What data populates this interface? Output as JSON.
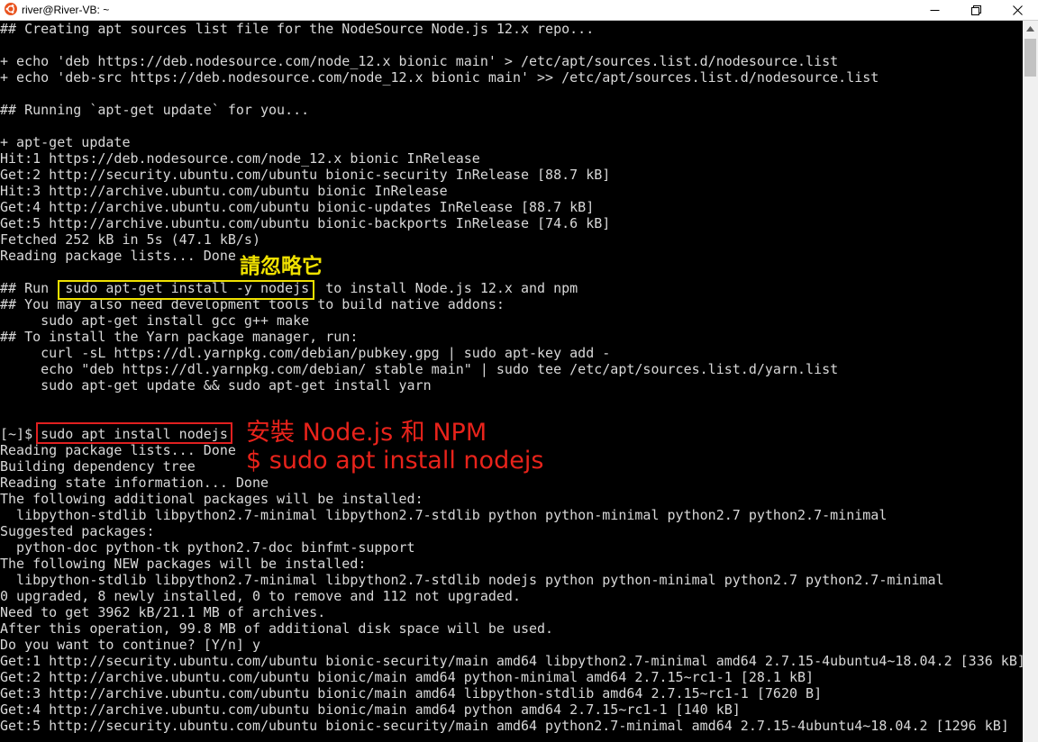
{
  "window": {
    "title": "river@River-VB: ~"
  },
  "icons": {
    "app": "ubuntu-logo-icon",
    "minimize": "minimize-icon",
    "maximize": "maximize-icon",
    "close": "close-icon",
    "scroll_up": "scroll-up-arrow-icon"
  },
  "colors": {
    "background": "#000000",
    "foreground": "#d8d8d8",
    "highlight_yellow": "#f0e100",
    "highlight_red": "#e02020",
    "ubuntu_orange": "#e95420"
  },
  "terminal": {
    "lines": [
      "## Creating apt sources list file for the NodeSource Node.js 12.x repo...",
      "",
      "+ echo 'deb https://deb.nodesource.com/node_12.x bionic main' > /etc/apt/sources.list.d/nodesource.list",
      "+ echo 'deb-src https://deb.nodesource.com/node_12.x bionic main' >> /etc/apt/sources.list.d/nodesource.list",
      "",
      "## Running `apt-get update` for you...",
      "",
      "+ apt-get update",
      "Hit:1 https://deb.nodesource.com/node_12.x bionic InRelease",
      "Get:2 http://security.ubuntu.com/ubuntu bionic-security InRelease [88.7 kB]",
      "Hit:3 http://archive.ubuntu.com/ubuntu bionic InRelease",
      "Get:4 http://archive.ubuntu.com/ubuntu bionic-updates InRelease [88.7 kB]",
      "Get:5 http://archive.ubuntu.com/ubuntu bionic-backports InRelease [74.6 kB]",
      "Fetched 252 kB in 5s (47.1 kB/s)",
      "Reading package lists... Done",
      "",
      "## Run  sudo apt-get install -y nodejs  to install Node.js 12.x and npm",
      "## You may also need development tools to build native addons:",
      "     sudo apt-get install gcc g++ make",
      "## To install the Yarn package manager, run:",
      "     curl -sL https://dl.yarnpkg.com/debian/pubkey.gpg | sudo apt-key add -",
      "     echo \"deb https://dl.yarnpkg.com/debian/ stable main\" | sudo tee /etc/apt/sources.list.d/yarn.list",
      "     sudo apt-get update && sudo apt-get install yarn",
      "",
      "",
      "[~]$ sudo apt install nodejs",
      "Reading package lists... Done",
      "Building dependency tree",
      "Reading state information... Done",
      "The following additional packages will be installed:",
      "  libpython-stdlib libpython2.7-minimal libpython2.7-stdlib python python-minimal python2.7 python2.7-minimal",
      "Suggested packages:",
      "  python-doc python-tk python2.7-doc binfmt-support",
      "The following NEW packages will be installed:",
      "  libpython-stdlib libpython2.7-minimal libpython2.7-stdlib nodejs python python-minimal python2.7 python2.7-minimal",
      "0 upgraded, 8 newly installed, 0 to remove and 112 not upgraded.",
      "Need to get 3962 kB/21.1 MB of archives.",
      "After this operation, 99.8 MB of additional disk space will be used.",
      "Do you want to continue? [Y/n] y",
      "Get:1 http://security.ubuntu.com/ubuntu bionic-security/main amd64 libpython2.7-minimal amd64 2.7.15-4ubuntu4~18.04.2 [336 kB]",
      "Get:2 http://archive.ubuntu.com/ubuntu bionic/main amd64 python-minimal amd64 2.7.15~rc1-1 [28.1 kB]",
      "Get:3 http://archive.ubuntu.com/ubuntu bionic/main amd64 libpython-stdlib amd64 2.7.15~rc1-1 [7620 B]",
      "Get:4 http://archive.ubuntu.com/ubuntu bionic/main amd64 python amd64 2.7.15~rc1-1 [140 kB]",
      "Get:5 http://security.ubuntu.com/ubuntu bionic-security/main amd64 python2.7-minimal amd64 2.7.15-4ubuntu4~18.04.2 [1296 kB]"
    ]
  },
  "annotations": {
    "ignore_note": "請忽略它",
    "install_title": "安裝 Node.js 和 NPM",
    "install_command": "$ sudo apt install nodejs"
  }
}
